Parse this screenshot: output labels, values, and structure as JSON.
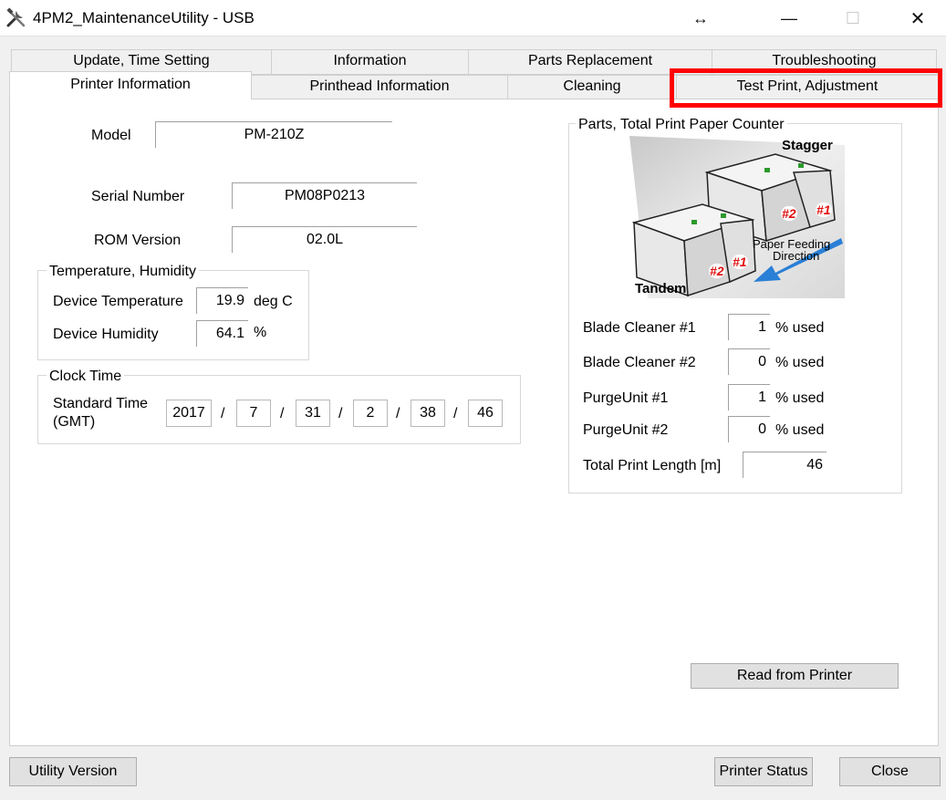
{
  "window": {
    "title": "4PM2_MaintenanceUtility - USB",
    "icon": "tools-icon",
    "resize_glyph": "↔",
    "minimize_glyph": "—",
    "maximize_glyph": "☐",
    "close_glyph": "✕"
  },
  "tabs": {
    "back_row": [
      "Update, Time Setting",
      "Information",
      "Parts Replacement",
      "Troubleshooting"
    ],
    "front_row": [
      "Printer Information",
      "Printhead Information",
      "Cleaning",
      "Test Print, Adjustment"
    ],
    "active": "Printer Information",
    "highlighted": "Test Print, Adjustment",
    "highlight_color": "#ff0000"
  },
  "printer_info": {
    "model_label": "Model",
    "model_value": "PM-210Z",
    "serial_label": "Serial Number",
    "serial_value": "PM08P0213",
    "rom_label": "ROM Version",
    "rom_value": "02.0L"
  },
  "temp_humidity": {
    "title": "Temperature, Humidity",
    "temp_label": "Device Temperature",
    "temp_value": "19.9",
    "temp_unit": "deg C",
    "humidity_label": "Device Humidity",
    "humidity_value": "64.1",
    "humidity_unit": "%"
  },
  "clock": {
    "title": "Clock Time",
    "label_line1": "Standard Time",
    "label_line2": "(GMT)",
    "year": "2017",
    "month": "7",
    "day": "31",
    "hour": "2",
    "minute": "38",
    "second": "46",
    "separator": "/"
  },
  "parts_counter": {
    "title": "Parts, Total Print Paper Counter",
    "diagram": {
      "stagger_label": "Stagger",
      "tandem_label": "Tandem",
      "head1": "#1",
      "head2": "#2",
      "feed_line1": "Paper Feeding",
      "feed_line2": "Direction"
    },
    "blade1_label": "Blade Cleaner #1",
    "blade1_value": "1",
    "blade2_label": "Blade Cleaner #2",
    "blade2_value": "0",
    "purge1_label": "PurgeUnit #1",
    "purge1_value": "1",
    "purge2_label": "PurgeUnit #2",
    "purge2_value": "0",
    "used_suffix": "% used",
    "total_label": "Total Print Length [m]",
    "total_value": "46"
  },
  "buttons": {
    "read": "Read from Printer",
    "utility_version": "Utility Version",
    "printer_status": "Printer Status",
    "close": "Close"
  }
}
